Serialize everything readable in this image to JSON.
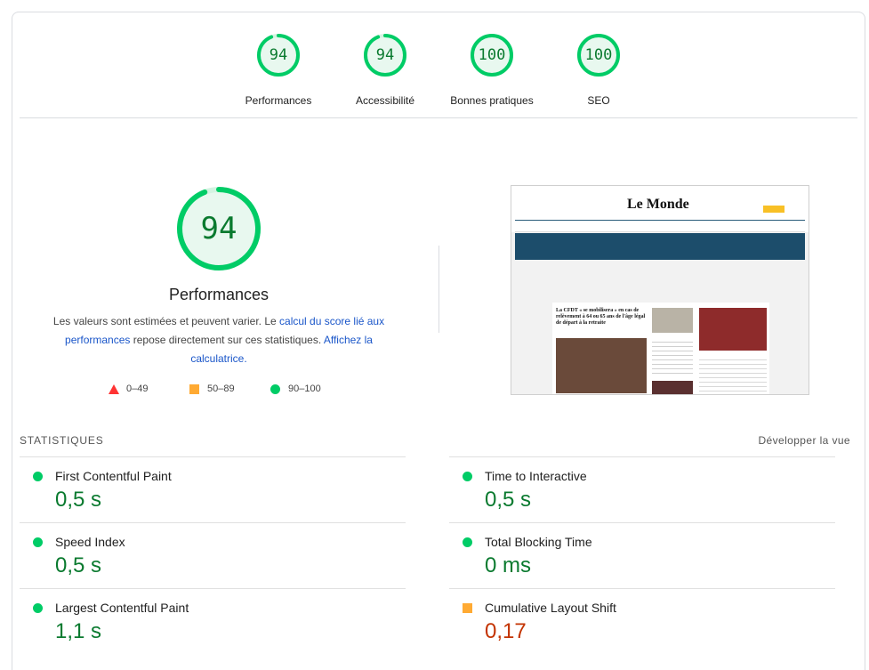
{
  "summary": {
    "gauges": [
      {
        "score": "94",
        "label": "Performances",
        "fraction": 0.94
      },
      {
        "score": "94",
        "label": "Accessibilité",
        "fraction": 0.94
      },
      {
        "score": "100",
        "label": "Bonnes pratiques",
        "fraction": 1.0
      },
      {
        "score": "100",
        "label": "SEO",
        "fraction": 1.0
      }
    ]
  },
  "performance": {
    "score": "94",
    "fraction": 0.94,
    "title": "Performances",
    "desc_part1": "Les valeurs sont estimées et peuvent varier. Le ",
    "desc_link1": "calcul du score lié aux performances",
    "desc_part2": " repose directement sur ces statistiques. ",
    "desc_link2": "Affichez la calculatrice.",
    "legend": [
      {
        "range": "0–49",
        "shape": "triangle",
        "color": "#ff3333"
      },
      {
        "range": "50–89",
        "shape": "square",
        "color": "#ffaa33"
      },
      {
        "range": "90–100",
        "shape": "circle",
        "color": "#00cc66"
      }
    ]
  },
  "thumbnail": {
    "site_title": "Le Monde",
    "headline": "La CFDT « se mobilisera » en cas de relèvement à 64 ou 65 ans de l'âge légal de départ à la retraite"
  },
  "statistics": {
    "header": "STATISTIQUES",
    "toggle": "Développer la vue",
    "metrics": [
      {
        "name": "First Contentful Paint",
        "value": "0,5 s",
        "status": "pass"
      },
      {
        "name": "Time to Interactive",
        "value": "0,5 s",
        "status": "pass"
      },
      {
        "name": "Speed Index",
        "value": "0,5 s",
        "status": "pass"
      },
      {
        "name": "Total Blocking Time",
        "value": "0 ms",
        "status": "pass"
      },
      {
        "name": "Largest Contentful Paint",
        "value": "1,1 s",
        "status": "pass"
      },
      {
        "name": "Cumulative Layout Shift",
        "value": "0,17",
        "status": "average"
      }
    ]
  },
  "colors": {
    "pass": "#0c6",
    "pass_text": "#0a7a2f",
    "average": "#fa3",
    "average_text": "#c33300",
    "link": "#1a56c9"
  }
}
